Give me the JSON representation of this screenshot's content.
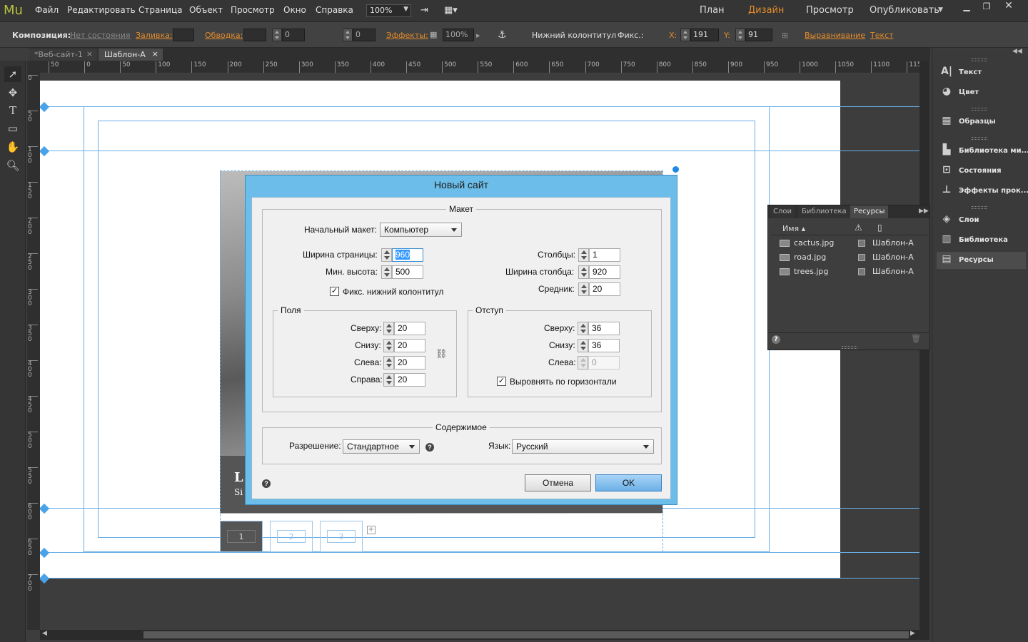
{
  "app": {
    "logo": "Mu",
    "menu": [
      "Файл",
      "Редактировать",
      "Страница",
      "Объект",
      "Просмотр",
      "Окно",
      "Справка"
    ],
    "zoom": "100%",
    "workspace_tabs": [
      "План",
      "Дизайн",
      "Просмотр",
      "Опубликовать"
    ],
    "active_workspace": "Дизайн",
    "accent_color": "#e38b2a"
  },
  "controlbar": {
    "composition_label": "Композиция:",
    "composition_value": "Нет состояния",
    "fill_label": "Заливка:",
    "stroke_label": "Обводка:",
    "stroke_value": "0",
    "corner_value": "0",
    "effects_label": "Эффекты:",
    "opacity_value": "100%",
    "footer_checkbox": "Нижний колонтитул",
    "fix_label": "Фикс.:",
    "x_label": "X:",
    "x_value": "191",
    "y_label": "Y:",
    "y_value": "91",
    "align_label": "Выравнивание",
    "text_label": "Текст"
  },
  "doc_tabs": [
    {
      "label": "*Веб-сайт-1",
      "close": "×"
    },
    {
      "label": "Шаблон-A",
      "close": "×"
    }
  ],
  "ruler_h": [
    "50",
    "0",
    "50",
    "100",
    "150",
    "200",
    "250",
    "300",
    "350",
    "400",
    "450",
    "500",
    "550",
    "600",
    "650",
    "700",
    "750",
    "800",
    "850",
    "900",
    "950",
    "1000",
    "1050",
    "1100",
    "1150"
  ],
  "ruler_v": [
    "0",
    "5\n0",
    "1\n0\n0",
    "1\n5\n0",
    "2\n0\n0",
    "2\n5\n0",
    "3\n0\n0",
    "3\n5\n0",
    "4\n0\n0",
    "4\n5\n0",
    "5\n0\n0",
    "5\n5\n0",
    "6\n0\n0",
    "6\n5\n0",
    "7\n0\n0"
  ],
  "canvas": {
    "footer_letter": "L",
    "footer_sub": "Si",
    "thumbs": [
      "1",
      "2",
      "3"
    ],
    "add": "+"
  },
  "right_panel": {
    "items": [
      {
        "icon": "text-icon",
        "glyph": "A|",
        "label": "Текст"
      },
      {
        "icon": "color-icon",
        "glyph": "◕",
        "label": "Цвет"
      },
      {
        "icon": "swatches-icon",
        "glyph": "▦",
        "label": "Образцы"
      },
      {
        "icon": "widget-library-icon",
        "glyph": "▙",
        "label": "Библиотека ми..."
      },
      {
        "icon": "states-icon",
        "glyph": "⊡",
        "label": "Состояния"
      },
      {
        "icon": "effects-icon",
        "glyph": "⊥",
        "label": "Эффекты прок..."
      },
      {
        "icon": "layers-icon",
        "glyph": "◈",
        "label": "Слои"
      },
      {
        "icon": "library-icon",
        "glyph": "▥",
        "label": "Библиотека"
      },
      {
        "icon": "assets-icon",
        "glyph": "▤",
        "label": "Ресурсы"
      }
    ]
  },
  "assets_panel": {
    "tabs": [
      "Слои",
      "Библиотека",
      "Ресурсы"
    ],
    "active_tab": "Ресурсы",
    "col_name": "Имя",
    "rows": [
      {
        "name": "cactus.jpg",
        "page": "Шаблон-A"
      },
      {
        "name": "road.jpg",
        "page": "Шаблон-A"
      },
      {
        "name": "trees.jpg",
        "page": "Шаблон-A"
      }
    ]
  },
  "dialog": {
    "title": "Новый сайт",
    "layout_legend": "Макет",
    "initial_layout_label": "Начальный макет:",
    "initial_layout_value": "Компьютер",
    "page_width_label": "Ширина страницы:",
    "page_width_value": "960",
    "min_height_label": "Мин. высота:",
    "min_height_value": "500",
    "sticky_footer_label": "Фикс. нижний колонтитул",
    "sticky_footer_checked": "✓",
    "columns_label": "Столбцы:",
    "columns_value": "1",
    "column_width_label": "Ширина столбца:",
    "column_width_value": "920",
    "gutter_label": "Средник:",
    "gutter_value": "20",
    "margins_legend": "Поля",
    "margin_top_label": "Сверху:",
    "margin_top_value": "20",
    "margin_bottom_label": "Снизу:",
    "margin_bottom_value": "20",
    "margin_left_label": "Слева:",
    "margin_left_value": "20",
    "margin_right_label": "Справа:",
    "margin_right_value": "20",
    "padding_legend": "Отступ",
    "padding_top_label": "Сверху:",
    "padding_top_value": "36",
    "padding_bottom_label": "Снизу:",
    "padding_bottom_value": "36",
    "padding_left_label": "Слева:",
    "padding_left_value": "0",
    "center_label": "Выровнять по горизонтали",
    "center_checked": "✓",
    "content_legend": "Содержимое",
    "resolution_label": "Разрешение:",
    "resolution_value": "Стандартное",
    "language_label": "Язык:",
    "language_value": "Русский",
    "help_glyph": "?",
    "cancel_label": "Отмена",
    "ok_label": "OK"
  }
}
